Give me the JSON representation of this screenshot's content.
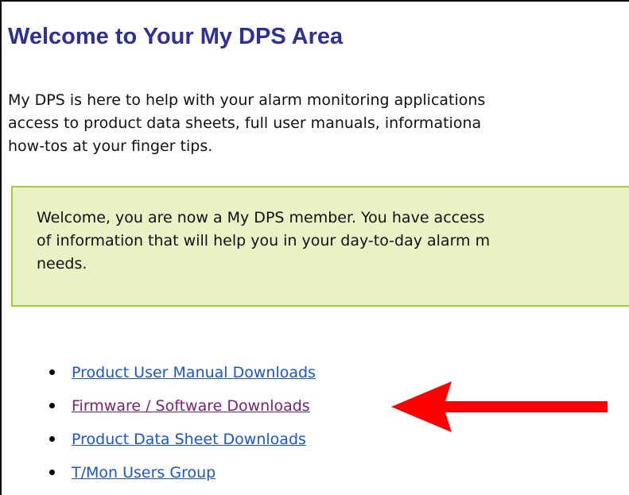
{
  "page": {
    "title": "Welcome to Your My DPS Area",
    "intro_lines": [
      "My DPS is here to help with your alarm monitoring applications",
      "access to product data sheets, full user manuals, informationa",
      "how-tos at your finger tips."
    ]
  },
  "welcome_box": {
    "lines": [
      "Welcome, you are now a My DPS member. You have access",
      "of information that will help you in your day-to-day alarm m",
      "needs."
    ]
  },
  "links": [
    {
      "label": "Product User Manual Downloads",
      "state": "unvisited"
    },
    {
      "label": "Firmware / Software Downloads",
      "state": "visited"
    },
    {
      "label": "Product Data Sheet Downloads",
      "state": "unvisited"
    },
    {
      "label": "T/Mon Users Group",
      "state": "unvisited"
    }
  ],
  "annotation": {
    "arrow_icon": "red-arrow-left-icon",
    "arrow_color": "#ff0000",
    "points_to": "Firmware / Software Downloads"
  },
  "colors": {
    "title": "#2e3192",
    "link": "#1a56c8",
    "link_visited": "#7a1f7a",
    "box_background": "#e8f2c4",
    "box_border": "#a2cc3f"
  }
}
